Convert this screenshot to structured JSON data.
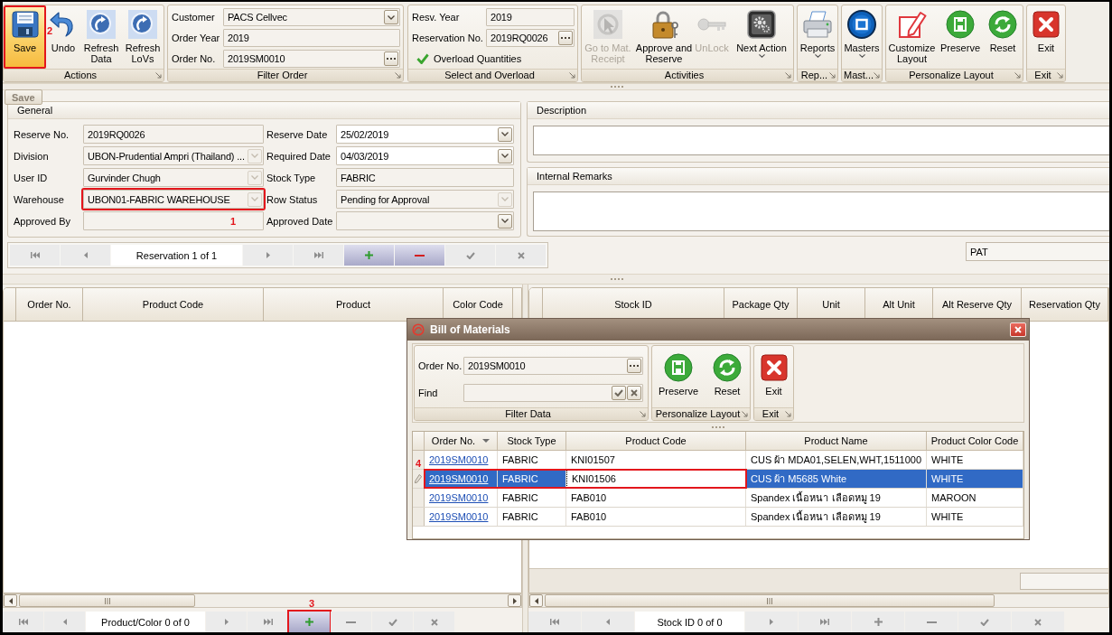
{
  "ribbon": {
    "groups": [
      {
        "label": "Actions",
        "kind": "buttons",
        "buttons": [
          {
            "label": "Save",
            "highlighted": true,
            "disabled": false,
            "menu": false,
            "callout": "2"
          },
          {
            "label": "Undo",
            "highlighted": false,
            "disabled": false,
            "menu": false
          },
          {
            "label": "Refresh Data",
            "highlighted": false,
            "disabled": false,
            "menu": false
          },
          {
            "label": "Refresh LoVs",
            "highlighted": false,
            "disabled": false,
            "menu": false
          }
        ]
      },
      {
        "label": "Filter Order",
        "kind": "fields",
        "fields": [
          {
            "label": "Customer",
            "value": "PACS Cellvec",
            "kind": "dropdown"
          },
          {
            "label": "Order Year",
            "value": "2019",
            "kind": "text"
          },
          {
            "label": "Order No.",
            "value": "2019SM0010",
            "kind": "lookup"
          }
        ]
      },
      {
        "label": "Select and Overload",
        "kind": "fields",
        "fields": [
          {
            "label": "Resv. Year",
            "value": "2019",
            "kind": "text"
          },
          {
            "label": "Reservation No.",
            "value": "2019RQ0026",
            "kind": "lookup"
          },
          {
            "label": "Overload Quantities",
            "kind": "check",
            "checked": true
          }
        ]
      },
      {
        "label": "Activities",
        "kind": "buttons",
        "buttons": [
          {
            "label": "Go to Mat. Receipt",
            "highlighted": false,
            "disabled": true,
            "menu": false
          },
          {
            "label": "Approve and Reserve",
            "highlighted": false,
            "disabled": false,
            "menu": false
          },
          {
            "label": "UnLock",
            "highlighted": false,
            "disabled": true,
            "menu": false
          },
          {
            "label": "Next Action",
            "highlighted": false,
            "disabled": false,
            "menu": true
          }
        ]
      },
      {
        "label": "Rep...",
        "kind": "buttons",
        "buttons": [
          {
            "label": "Reports",
            "highlighted": false,
            "disabled": false,
            "menu": true
          }
        ]
      },
      {
        "label": "Mast...",
        "kind": "buttons",
        "buttons": [
          {
            "label": "Masters",
            "highlighted": false,
            "disabled": false,
            "menu": true
          }
        ]
      },
      {
        "label": "Personalize Layout",
        "kind": "buttons",
        "buttons": [
          {
            "label": "Customize Layout",
            "highlighted": false,
            "disabled": false,
            "menu": false
          },
          {
            "label": "Preserve",
            "highlighted": false,
            "disabled": false,
            "menu": false
          },
          {
            "label": "Reset",
            "highlighted": false,
            "disabled": false,
            "menu": false
          }
        ]
      },
      {
        "label": "Exit",
        "kind": "buttons",
        "buttons": [
          {
            "label": "Exit",
            "highlighted": false,
            "disabled": false,
            "menu": false
          }
        ]
      }
    ]
  },
  "tooltip": "Save",
  "general": {
    "title": "General",
    "fields": [
      {
        "label": "Reserve No.",
        "value": "2019RQ0026",
        "kind": "text",
        "readonly": true,
        "disabled": false
      },
      {
        "label": "Reserve Date",
        "value": "25/02/2019",
        "kind": "dropdown",
        "readonly": false,
        "disabled": false
      },
      {
        "label": "Division",
        "value": "UBON-Prudential Ampri (Thailand) ...",
        "kind": "dropdown",
        "readonly": true,
        "disabled": true
      },
      {
        "label": "Required Date",
        "value": "04/03/2019",
        "kind": "dropdown",
        "readonly": false,
        "disabled": false
      },
      {
        "label": "User ID",
        "value": "Gurvinder Chugh",
        "kind": "dropdown",
        "readonly": true,
        "disabled": true
      },
      {
        "label": "Stock Type",
        "value": "FABRIC",
        "kind": "text",
        "readonly": true,
        "disabled": false
      },
      {
        "label": "Warehouse",
        "value": "UBON01-FABRIC WAREHOUSE",
        "kind": "dropdown",
        "readonly": true,
        "disabled": true,
        "callout": "1"
      },
      {
        "label": "Row Status",
        "value": "Pending for Approval",
        "kind": "dropdown",
        "readonly": true,
        "disabled": true
      },
      {
        "label": "Approved By",
        "kind": "text",
        "readonly": true,
        "disabled": false
      },
      {
        "label": "Approved Date",
        "kind": "dropdown",
        "readonly": true,
        "disabled": false
      }
    ]
  },
  "description": {
    "title": "Description"
  },
  "internal_remarks": {
    "title": "Internal Remarks"
  },
  "reservation_navigator": {
    "caption": "Reservation 1 of 1",
    "buttons": [
      {
        "kind": "first",
        "highlighted": false
      },
      {
        "kind": "prev",
        "highlighted": false
      },
      {
        "kind": "next",
        "highlighted": false
      },
      {
        "kind": "last",
        "highlighted": false
      },
      {
        "kind": "add",
        "highlighted": true
      },
      {
        "kind": "remove",
        "highlighted": true
      },
      {
        "kind": "accept",
        "highlighted": false
      },
      {
        "kind": "cancel",
        "highlighted": false
      }
    ]
  },
  "text_field": {
    "value": "PAT"
  },
  "products_grid": {
    "columns": [
      "Order No.",
      "Product Code",
      "Product",
      "Color Code"
    ],
    "navigator": {
      "caption": "Product/Color 0 of 0",
      "buttons": [
        {
          "kind": "first",
          "highlighted": false
        },
        {
          "kind": "prev",
          "highlighted": false
        },
        {
          "kind": "next",
          "highlighted": false
        },
        {
          "kind": "last",
          "highlighted": false
        },
        {
          "kind": "add",
          "highlighted": true,
          "callout": "3"
        },
        {
          "kind": "remove",
          "highlighted": false
        },
        {
          "kind": "accept",
          "highlighted": false
        },
        {
          "kind": "cancel",
          "highlighted": false
        }
      ]
    }
  },
  "stock_grid": {
    "columns": [
      "Stock ID",
      "Package Qty",
      "Unit",
      "Alt Unit",
      "Alt Reserve Qty",
      "Reservation Qty"
    ],
    "navigator": {
      "caption": "Stock ID 0 of 0",
      "buttons": [
        {
          "kind": "first",
          "highlighted": false
        },
        {
          "kind": "prev",
          "highlighted": false
        },
        {
          "kind": "next",
          "highlighted": false
        },
        {
          "kind": "last",
          "highlighted": false
        },
        {
          "kind": "add",
          "highlighted": false
        },
        {
          "kind": "remove",
          "highlighted": false
        },
        {
          "kind": "accept",
          "highlighted": false
        },
        {
          "kind": "cancel",
          "highlighted": false
        }
      ]
    }
  },
  "dialog": {
    "title": "Bill of Materials",
    "ribbon": {
      "groups": [
        {
          "label": "Filter Data",
          "kind": "fields",
          "fields": [
            {
              "label": "Order No.",
              "value": "2019SM0010",
              "kind": "lookup"
            },
            {
              "label": "Find",
              "kind": "search"
            }
          ]
        },
        {
          "label": "Personalize Layout",
          "kind": "buttons",
          "buttons": [
            {
              "label": "Preserve",
              "highlighted": false,
              "disabled": false,
              "menu": false
            },
            {
              "label": "Reset",
              "highlighted": false,
              "disabled": false,
              "menu": false
            }
          ]
        },
        {
          "label": "Exit",
          "kind": "buttons",
          "buttons": [
            {
              "label": "Exit",
              "highlighted": false,
              "disabled": false,
              "menu": false
            }
          ]
        }
      ]
    },
    "grid": {
      "columns": [
        {
          "label": "Order No.",
          "sorted": true
        },
        {
          "label": "Stock Type",
          "sorted": false
        },
        {
          "label": "Product Code",
          "sorted": false
        },
        {
          "label": "Product Name",
          "sorted": false
        },
        {
          "label": "Product Color Code",
          "sorted": false
        }
      ],
      "rows": [
        {
          "order_no": "2019SM0010",
          "stock_type": "FABRIC",
          "product_code": "KNI01507",
          "product_name": "CUS ผ้า MDA01,SELEN,WHT,1511000",
          "color_code": "WHITE",
          "selected": false,
          "editing": false
        },
        {
          "order_no": "2019SM0010",
          "stock_type": "FABRIC",
          "product_code": "KNI01506",
          "product_name": "CUS ผ้า M5685 White",
          "color_code": "WHITE",
          "selected": true,
          "editing": true,
          "callout": "4"
        },
        {
          "order_no": "2019SM0010",
          "stock_type": "FABRIC",
          "product_code": "FAB010",
          "product_name": "Spandex เนื้อหนา เลือดหมู 19",
          "color_code": "MAROON",
          "selected": false,
          "editing": false
        },
        {
          "order_no": "2019SM0010",
          "stock_type": "FABRIC",
          "product_code": "FAB010",
          "product_name": "Spandex เนื้อหนา เลือดหมู 19",
          "color_code": "WHITE",
          "selected": false,
          "editing": false
        }
      ]
    }
  }
}
